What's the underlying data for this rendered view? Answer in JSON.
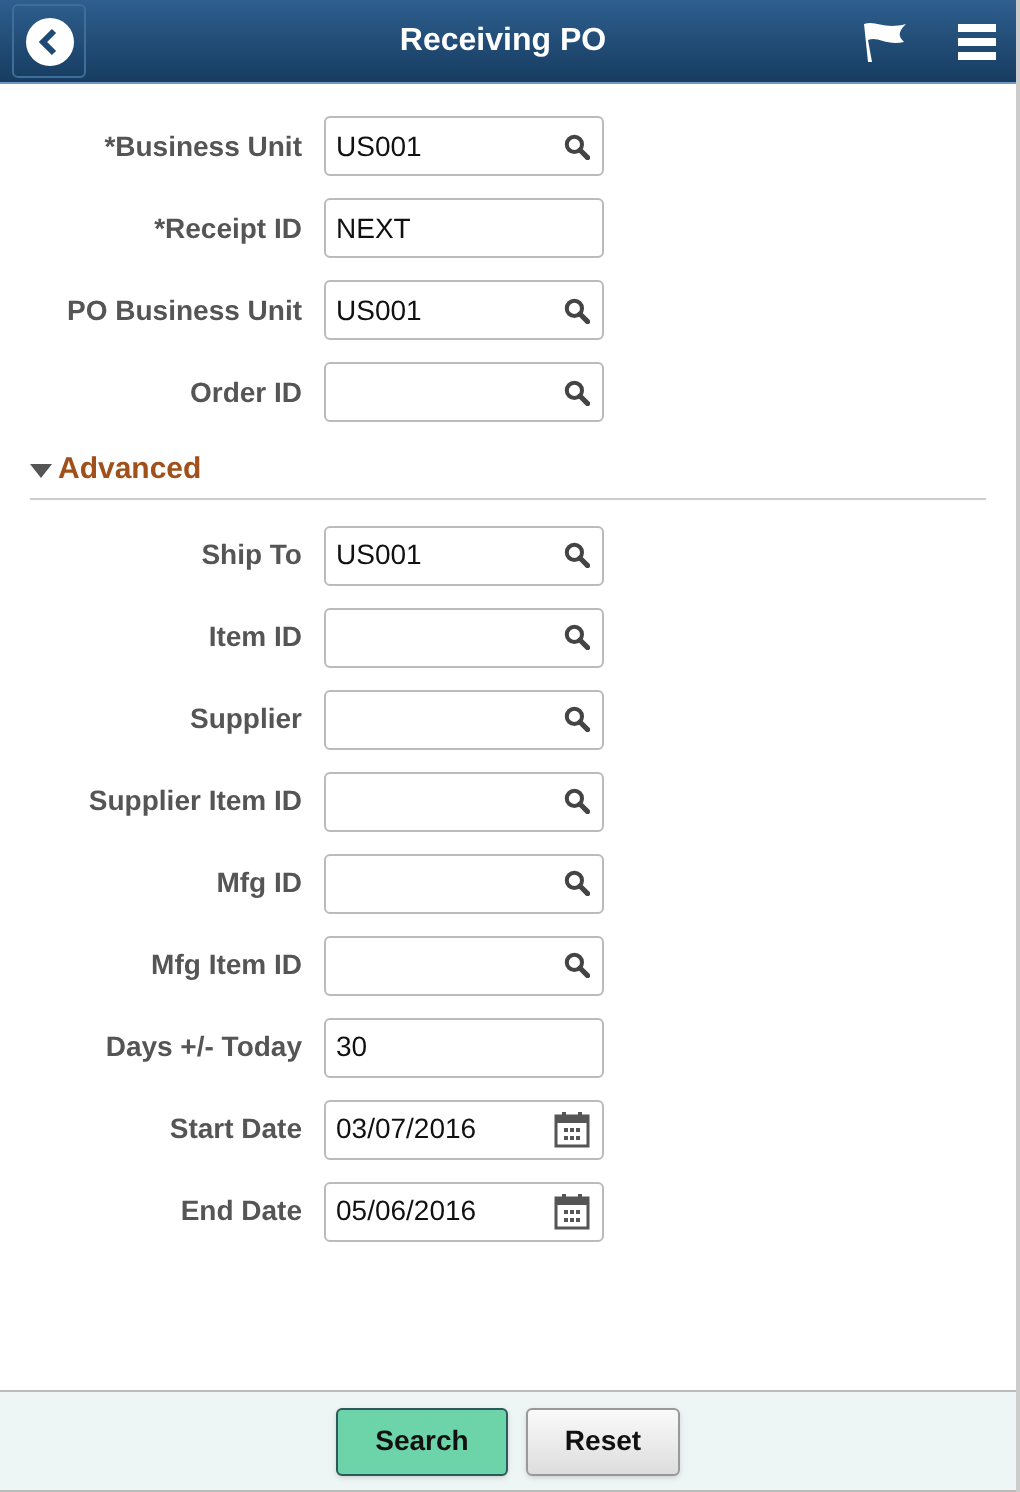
{
  "header": {
    "title": "Receiving PO"
  },
  "fields": [
    {
      "label": "*Business Unit",
      "value": "US001",
      "kind": "lookup"
    },
    {
      "label": "*Receipt ID",
      "value": "NEXT",
      "kind": "text"
    },
    {
      "label": "PO Business Unit",
      "value": "US001",
      "kind": "lookup"
    },
    {
      "label": "Order ID",
      "kind": "lookup"
    }
  ],
  "advanced": {
    "title": "Advanced",
    "expanded": true,
    "fields": [
      {
        "label": "Ship To",
        "value": "US001",
        "kind": "lookup"
      },
      {
        "label": "Item ID",
        "kind": "lookup"
      },
      {
        "label": "Supplier",
        "kind": "lookup"
      },
      {
        "label": "Supplier Item ID",
        "kind": "lookup"
      },
      {
        "label": "Mfg ID",
        "kind": "lookup"
      },
      {
        "label": "Mfg Item ID",
        "kind": "lookup"
      },
      {
        "label": "Days +/- Today",
        "value": "30",
        "kind": "text"
      },
      {
        "label": "Start Date",
        "value": "03/07/2016",
        "kind": "date"
      },
      {
        "label": "End Date",
        "value": "05/06/2016",
        "kind": "date"
      }
    ]
  },
  "buttons": [
    {
      "label": "Search",
      "kind": "primary"
    },
    {
      "label": "Reset",
      "kind": "secondary"
    }
  ]
}
